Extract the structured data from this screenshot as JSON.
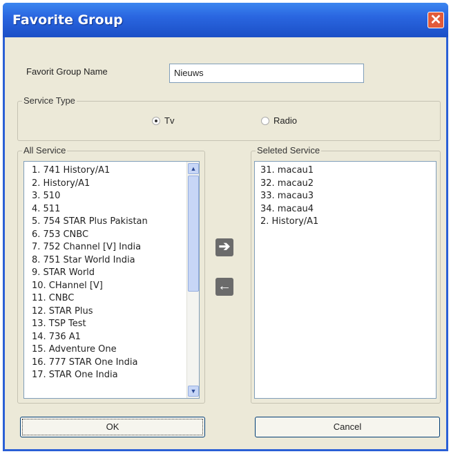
{
  "window": {
    "title": "Favorite Group",
    "close_glyph": "✕"
  },
  "group_name": {
    "label": "Favorit Group Name",
    "value": "Nieuws"
  },
  "service_type": {
    "label": "Service Type",
    "options": [
      {
        "label": "Tv",
        "checked": true
      },
      {
        "label": "Radio",
        "checked": false
      }
    ]
  },
  "all_service": {
    "label": "All Service",
    "items": [
      "1. 741 History/A1",
      "2. History/A1",
      "3. 510",
      "4. 511",
      "5. 754 STAR Plus Pakistan",
      "6. 753 CNBC",
      "7. 752 Channel [V] India",
      "8. 751 Star World India",
      "9. STAR World",
      "10. CHannel [V]",
      "11. CNBC",
      "12. STAR Plus",
      "13. TSP Test",
      "14. 736 A1",
      "15. Adventure One",
      "16. 777 STAR One India",
      "17. STAR One India"
    ]
  },
  "selected_service": {
    "label": "Seleted Service",
    "items": [
      "31. macau1",
      "32. macau2",
      "33. macau3",
      "34. macau4",
      "2. History/A1"
    ]
  },
  "move_right": {
    "glyph": "➔",
    "icon": "arrow-right-icon"
  },
  "move_left": {
    "glyph": "🡐",
    "icon": "arrow-left-icon"
  },
  "buttons": {
    "ok": "OK",
    "cancel": "Cancel"
  }
}
